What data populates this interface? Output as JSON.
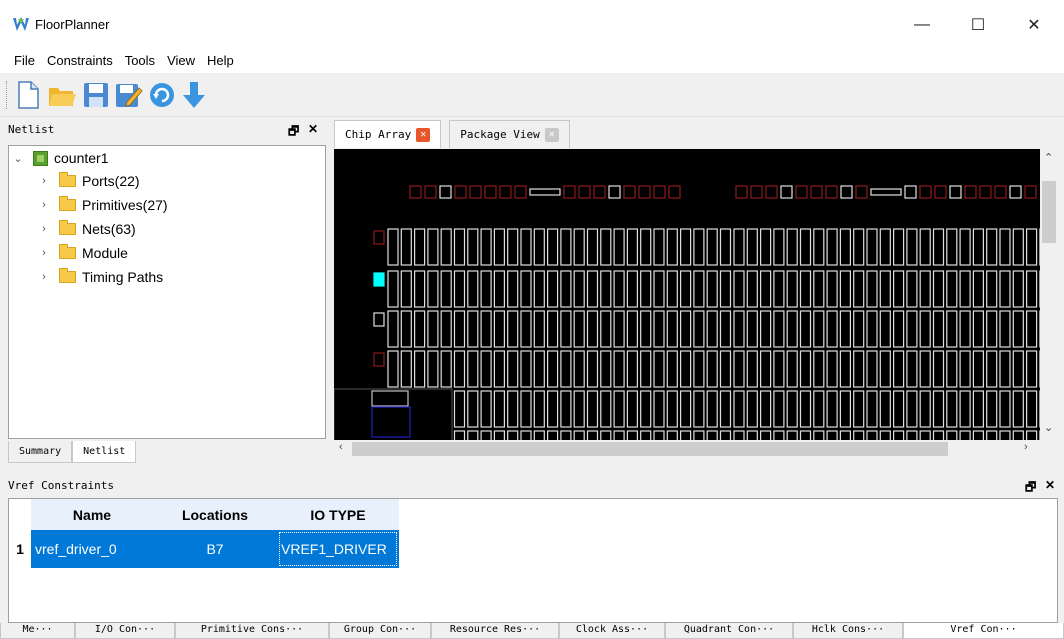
{
  "window": {
    "title": "FloorPlanner",
    "minimize": "—",
    "maximize": "☐",
    "close": "✕"
  },
  "menu": [
    {
      "label": "File"
    },
    {
      "label": "Constraints"
    },
    {
      "label": "Tools"
    },
    {
      "label": "View"
    },
    {
      "label": "Help"
    }
  ],
  "toolbar": {
    "buttons": [
      "new-file-icon",
      "open-folder-icon",
      "save-icon",
      "save-as-icon",
      "refresh-icon",
      "download-icon"
    ]
  },
  "netlist_panel": {
    "title": "Netlist",
    "tree_root": "counter1",
    "tree_items": [
      {
        "label": "Ports(22)"
      },
      {
        "label": "Primitives(27)"
      },
      {
        "label": "Nets(63)"
      },
      {
        "label": "Module"
      },
      {
        "label": "Timing Paths"
      }
    ],
    "tabs": [
      {
        "label": "Summary"
      },
      {
        "label": "Netlist",
        "active": true
      }
    ]
  },
  "chip_view": {
    "tabs": [
      {
        "label": "Chip Array",
        "active": true
      },
      {
        "label": "Package View",
        "active": false
      }
    ]
  },
  "vref_panel": {
    "title": "Vref Constraints",
    "columns": [
      "Name",
      "Locations",
      "IO TYPE"
    ],
    "rows": [
      {
        "index": "1",
        "name": "vref_driver_0",
        "location": "B7",
        "io_type": "VREF1_DRIVER"
      }
    ]
  },
  "bottom_tabs": [
    {
      "label": "Me···"
    },
    {
      "label": "I/O Con···"
    },
    {
      "label": "Primitive Cons···"
    },
    {
      "label": "Group Con···"
    },
    {
      "label": "Resource Res···"
    },
    {
      "label": "Clock Ass···"
    },
    {
      "label": "Quadrant Con···"
    },
    {
      "label": "Hclk Cons···"
    },
    {
      "label": "Vref Con···",
      "active": true
    }
  ],
  "colors": {
    "selection": "#0078d7",
    "chip_background": "#000000",
    "bank_red": "#8b1a1a",
    "cell_white": "#e0e0e0",
    "cell_cyan": "#00ffff"
  }
}
